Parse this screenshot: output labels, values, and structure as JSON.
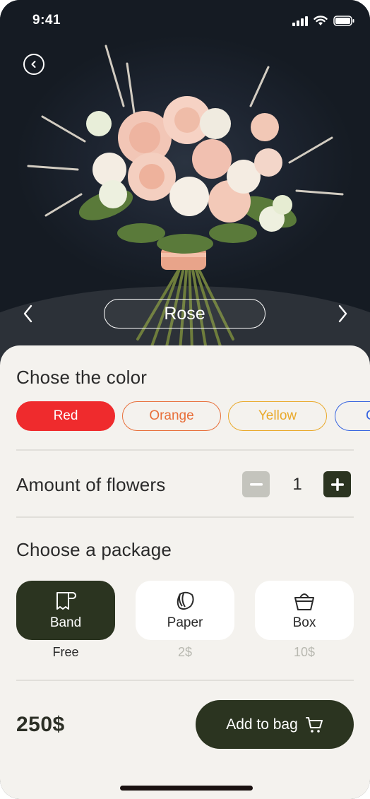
{
  "status": {
    "time": "9:41"
  },
  "product": {
    "name": "Rose"
  },
  "color_section": {
    "title": "Chose the color",
    "options": [
      {
        "label": "Red",
        "color": "#ef2b2d",
        "selected": true
      },
      {
        "label": "Orange",
        "color": "#e86f3a",
        "selected": false
      },
      {
        "label": "Yellow",
        "color": "#e9a92a",
        "selected": false
      },
      {
        "label": "C",
        "color": "#3563e0",
        "selected": false
      }
    ]
  },
  "amount_section": {
    "title": "Amount of flowers",
    "quantity": "1"
  },
  "package_section": {
    "title": "Choose a package",
    "options": [
      {
        "label": "Band",
        "price": "Free",
        "icon": "band-icon",
        "selected": true
      },
      {
        "label": "Paper",
        "price": "2$",
        "icon": "paper-icon",
        "selected": false
      },
      {
        "label": "Box",
        "price": "10$",
        "icon": "box-icon",
        "selected": false
      }
    ]
  },
  "checkout": {
    "total": "250$",
    "add_label": "Add to bag"
  },
  "colors": {
    "dark_green": "#2b3420",
    "sheet_bg": "#f4f2ee",
    "muted": "#b8b8b0"
  }
}
